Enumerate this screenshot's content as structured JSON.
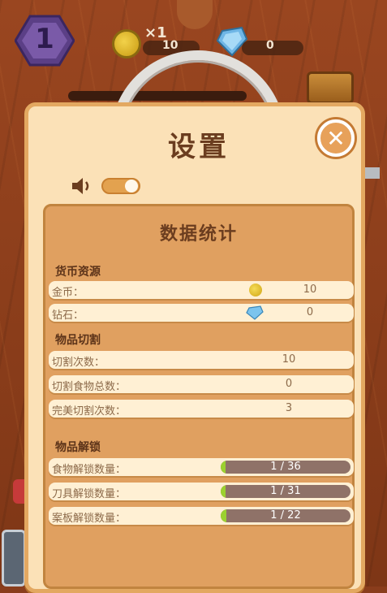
{
  "hud": {
    "level": "1",
    "coin_multiplier": "×1",
    "coin_count": "10",
    "gem_count": "0",
    "icons": [
      "level-hexagon-icon",
      "coin-icon",
      "gem-icon",
      "treasure-chest-icon"
    ]
  },
  "settings": {
    "title": "设置",
    "close_label": "✕",
    "sound_enabled": true,
    "stats": {
      "title": "数据统计",
      "currency": {
        "heading": "货币资源",
        "gold_label": "金币：",
        "gold_value": "10",
        "diamond_label": "钻石：",
        "diamond_value": "0"
      },
      "cutting": {
        "heading": "物品切割",
        "cut_count_label": "切割次数：",
        "cut_count_value": "10",
        "food_cut_label": "切割食物总数：",
        "food_cut_value": "0",
        "perfect_cut_label": "完美切割次数：",
        "perfect_cut_value": "3"
      },
      "unlock": {
        "heading": "物品解锁",
        "food_label": "食物解锁数量：",
        "food_text": "1 / 36",
        "food_progress": 0.028,
        "knife_label": "刀具解锁数量：",
        "knife_text": "1 / 31",
        "knife_progress": 0.032,
        "board_label": "案板解锁数量：",
        "board_text": "1 / 22",
        "board_progress": 0.045
      }
    }
  },
  "colors": {
    "panel_bg": "#fbe1b7",
    "panel_border": "#e3a861",
    "stats_bg": "#e0a060",
    "progress_fill": "#9bd12f",
    "progress_track": "#8f7268",
    "title_text": "#6b3d1f"
  }
}
